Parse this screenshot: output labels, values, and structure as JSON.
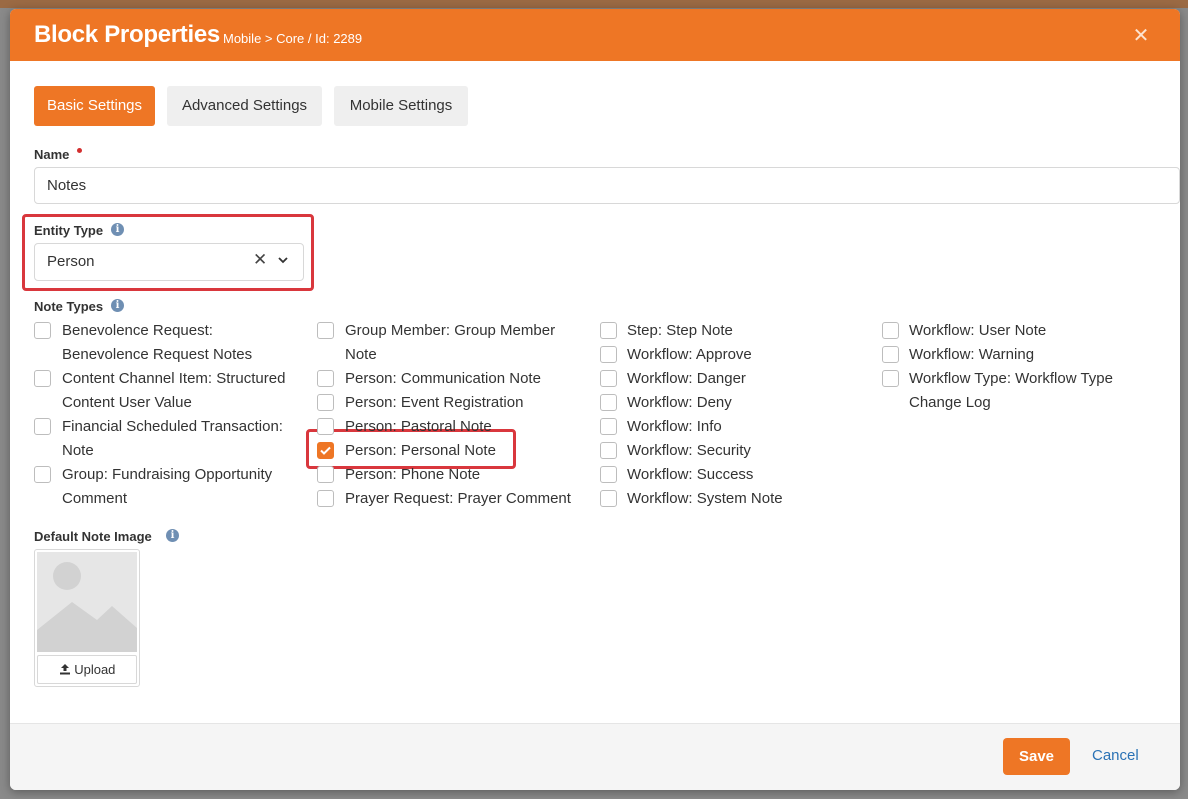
{
  "modal": {
    "title": "Block Properties",
    "subtitle": "Mobile > Core / Id: 2289",
    "close_icon": "close-icon"
  },
  "tabs": [
    {
      "label": "Basic Settings",
      "active": true
    },
    {
      "label": "Advanced Settings",
      "active": false
    },
    {
      "label": "Mobile Settings",
      "active": false
    }
  ],
  "name_field": {
    "label": "Name",
    "required": true,
    "value": "Notes"
  },
  "entity_type": {
    "label": "Entity Type",
    "value": "Person",
    "info_icon": "info-icon"
  },
  "note_types": {
    "label": "Note Types",
    "options": [
      {
        "label": "Benevolence Request: Benevolence Request Notes",
        "checked": false
      },
      {
        "label": "Content Channel Item: Structured Content User Value",
        "checked": false
      },
      {
        "label": "Financial Scheduled Transaction: Note",
        "checked": false
      },
      {
        "label": "Group: Fundraising Opportunity Comment",
        "checked": false
      },
      {
        "label": "Group Member: Group Member Note",
        "checked": false
      },
      {
        "label": "Person: Communication Note",
        "checked": false
      },
      {
        "label": "Person: Event Registration",
        "checked": false
      },
      {
        "label": "Person: Pastoral Note",
        "checked": false
      },
      {
        "label": "Person: Personal Note",
        "checked": true
      },
      {
        "label": "Person: Phone Note",
        "checked": false
      },
      {
        "label": "Prayer Request: Prayer Comment",
        "checked": false
      },
      {
        "label": "Step: Step Note",
        "checked": false
      },
      {
        "label": "Workflow: Approve",
        "checked": false
      },
      {
        "label": "Workflow: Danger",
        "checked": false
      },
      {
        "label": "Workflow: Deny",
        "checked": false
      },
      {
        "label": "Workflow: Info",
        "checked": false
      },
      {
        "label": "Workflow: Security",
        "checked": false
      },
      {
        "label": "Workflow: Success",
        "checked": false
      },
      {
        "label": "Workflow: System Note",
        "checked": false
      },
      {
        "label": "Workflow: User Note",
        "checked": false
      },
      {
        "label": "Workflow: Warning",
        "checked": false
      },
      {
        "label": "Workflow Type: Workflow Type Change Log",
        "checked": false
      }
    ]
  },
  "default_note_image": {
    "label": "Default Note Image",
    "upload_label": "Upload"
  },
  "footer": {
    "save_label": "Save",
    "cancel_label": "Cancel"
  },
  "colors": {
    "accent": "#ee7625",
    "highlight": "#d9373d",
    "link": "#2a72b5"
  }
}
